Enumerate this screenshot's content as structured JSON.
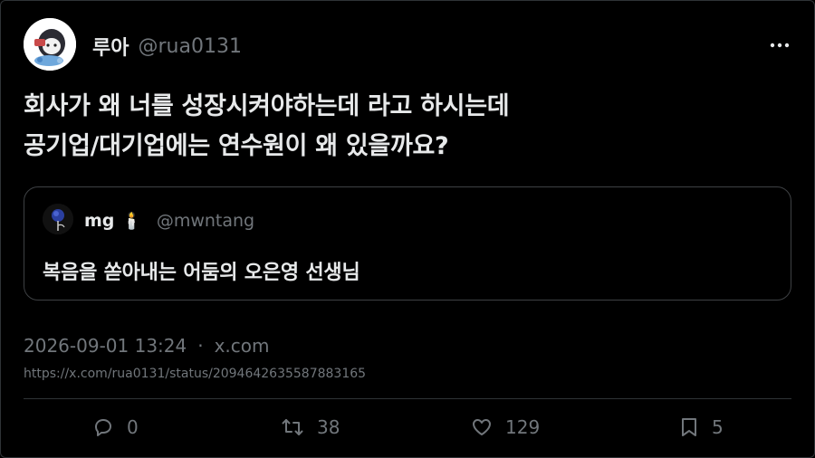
{
  "author": {
    "name": "루아",
    "handle": "@rua0131"
  },
  "tweet": {
    "text": "회사가 왜 너를 성장시켜야하는데 라고 하시는데\n공기업/대기업에는 연수원이 왜 있을까요?"
  },
  "quote": {
    "name": "mg",
    "emoji": "🕯️",
    "handle": "@mwntang",
    "text": "복음을 쏟아내는 어둠의 오은영 선생님"
  },
  "meta": {
    "timestamp": "2026-09-01 13:24",
    "separator": "·",
    "source": "x.com",
    "url": "https://x.com/rua0131/status/2094642635587883165"
  },
  "actions": {
    "reply_count": "0",
    "retweet_count": "38",
    "like_count": "129",
    "bookmark_count": "5"
  },
  "colors": {
    "background": "#000000",
    "text": "#e7e9ea",
    "muted": "#71767b",
    "border": "#2f3336"
  },
  "icons": [
    "more-icon",
    "reply-icon",
    "retweet-icon",
    "like-icon",
    "bookmark-icon"
  ]
}
